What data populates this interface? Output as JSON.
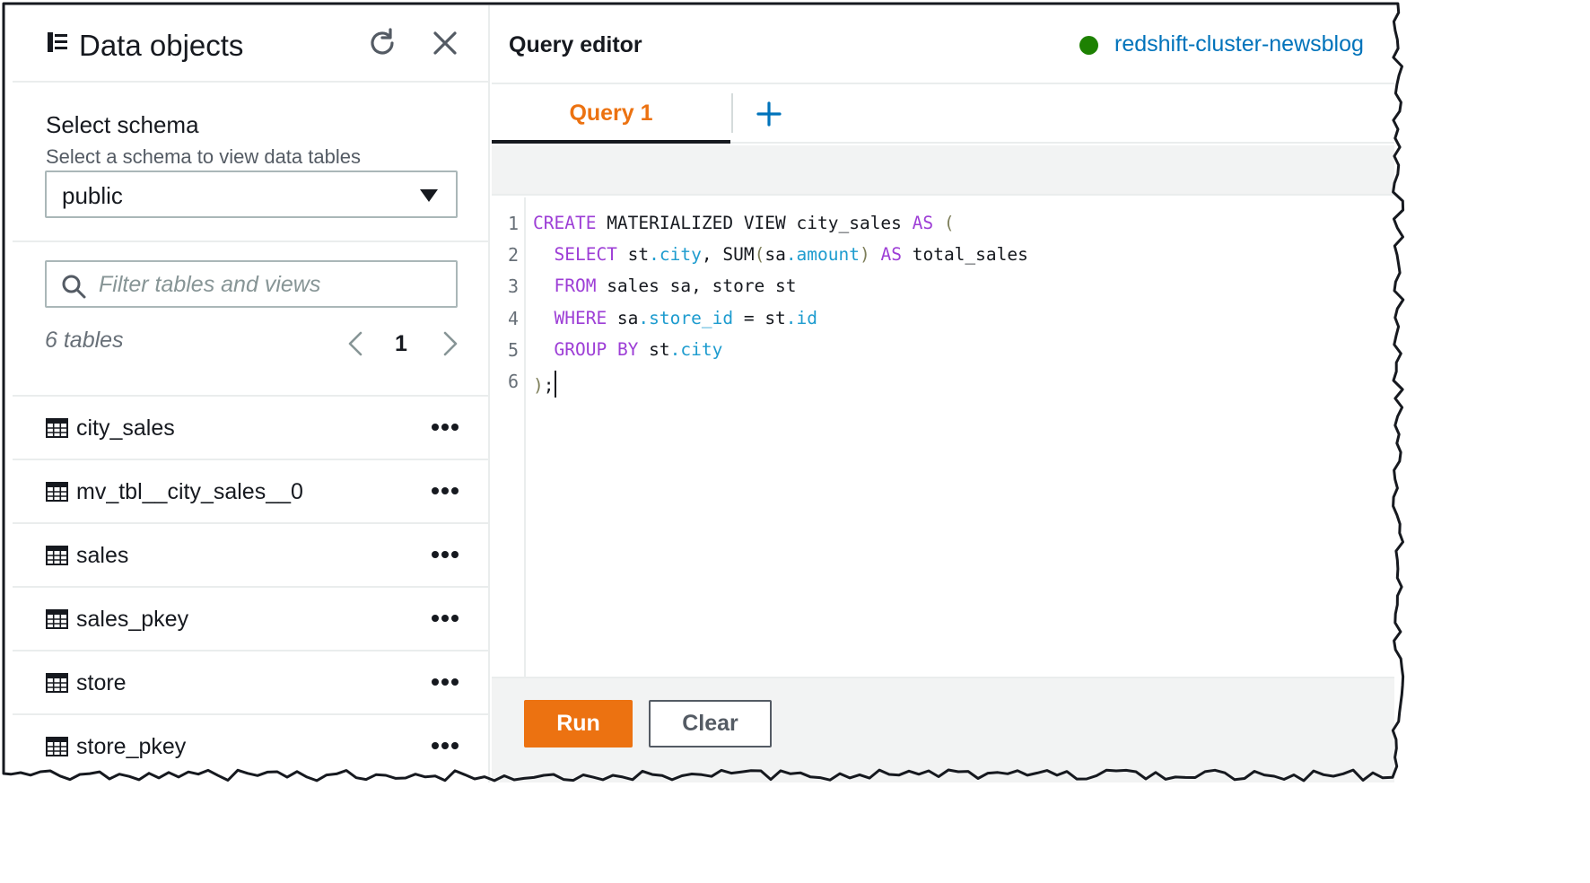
{
  "data_objects": {
    "title": "Data objects",
    "icons": {
      "title": "data-objects-icon",
      "refresh": "refresh-icon",
      "close": "close-icon"
    },
    "schema": {
      "label": "Select schema",
      "description": "Select a schema to view data tables",
      "selected": "public"
    },
    "filter": {
      "placeholder": "Filter tables and views",
      "value": ""
    },
    "table_count": "6 tables",
    "pager": {
      "page": "1"
    },
    "tables": [
      {
        "name": "city_sales"
      },
      {
        "name": "mv_tbl__city_sales__0"
      },
      {
        "name": "sales"
      },
      {
        "name": "sales_pkey"
      },
      {
        "name": "store"
      },
      {
        "name": "store_pkey"
      }
    ]
  },
  "query_editor": {
    "title": "Query editor",
    "cluster": {
      "name": "redshift-cluster-newsblog",
      "status_color": "#1d8102"
    },
    "tabs": [
      {
        "label": "Query 1",
        "active": true
      }
    ],
    "code_lines": [
      {
        "number": "1",
        "text": "CREATE MATERIALIZED VIEW city_sales AS ("
      },
      {
        "number": "2",
        "text": "  SELECT st.city, SUM(sa.amount) AS total_sales"
      },
      {
        "number": "3",
        "text": "  FROM sales sa, store st"
      },
      {
        "number": "4",
        "text": "  WHERE sa.store_id = st.id"
      },
      {
        "number": "5",
        "text": "  GROUP BY st.city"
      },
      {
        "number": "6",
        "text": ");"
      }
    ],
    "actions": {
      "run": "Run",
      "clear": "Clear"
    }
  },
  "colors": {
    "accent": "#ec7211",
    "link": "#0073bb",
    "keyword": "#9d3ed6",
    "property": "#1e9ccf"
  }
}
